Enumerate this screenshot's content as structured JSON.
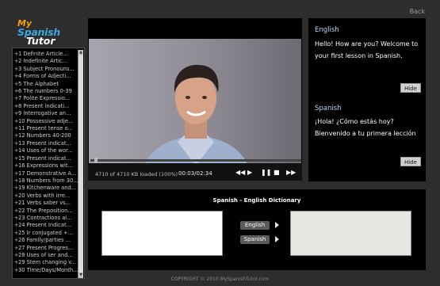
{
  "header": {
    "back_label": "Back"
  },
  "logo": {
    "line1": "My",
    "line2": "Spanish",
    "line3": "Tutor"
  },
  "lessons": [
    "1 Definite Article...",
    "2 Indefinite Artic...",
    "3 Subject Pronouns...",
    "4 Forms of Adjecti...",
    "5 The Alphabet",
    "6 The numbers 0-39",
    "7 Polite Expressio...",
    "8 Present indicati...",
    "9 Interrogative an...",
    "10 Possessive adje...",
    "11 Present tense o...",
    "12 Numbers 40-200",
    "13 Present indicat...",
    "14 Uses of the wor...",
    "15 Present indicat...",
    "16 Expressions wit...",
    "17 Demonstrative A...",
    "18 Numbers from 30...",
    "19 Kitchenware and...",
    "20 Verbs with irre...",
    "21 Verbs saber vs...",
    "22 The Preposition...",
    "23 Contractions al...",
    "24 Present Indicat...",
    "25 Ir conjugated +...",
    "26 Family/parties ...",
    "27 Present Progres...",
    "28 Uses of ser and...",
    "29 Stem changing v...",
    "30 Time/Days/Month..."
  ],
  "video": {
    "load_status": "4710 of 4710 KB loaded (100%)",
    "time": "00:03/02:34",
    "progress": 0.02,
    "controls": {
      "rewind": "◀◀",
      "play": "▶",
      "pause": "❚❚",
      "stop": "■",
      "forward": "▶▶"
    }
  },
  "translation": {
    "english_heading": "English",
    "english_text": "Hello! How are you? Welcome to your first lesson in Spanish.",
    "spanish_heading": "Spanish",
    "spanish_text": "¡Hola! ¿Cómo estás hoy? Bienvenido a tu primera lección",
    "hide_label": "Hide"
  },
  "dictionary": {
    "title": "Spanish - English Dictionary",
    "english_button": "English",
    "spanish_button": "Spanish",
    "input_value": "",
    "output_value": ""
  },
  "footer": {
    "copyright": "COPYRIGHT © 2010 MySpanishTutor.com"
  },
  "colors": {
    "background": "#2d2d2d",
    "panel": "#000000",
    "logo_orange": "#f2a007",
    "logo_blue": "#3aa7e0",
    "heading_blue": "#b7d8f2"
  },
  "icons": {
    "lesson_bullet": "plus-icon",
    "scroll_up": "arrow-up-icon",
    "scroll_down": "arrow-down-icon",
    "translate_arrow": "arrow-right-icon"
  }
}
